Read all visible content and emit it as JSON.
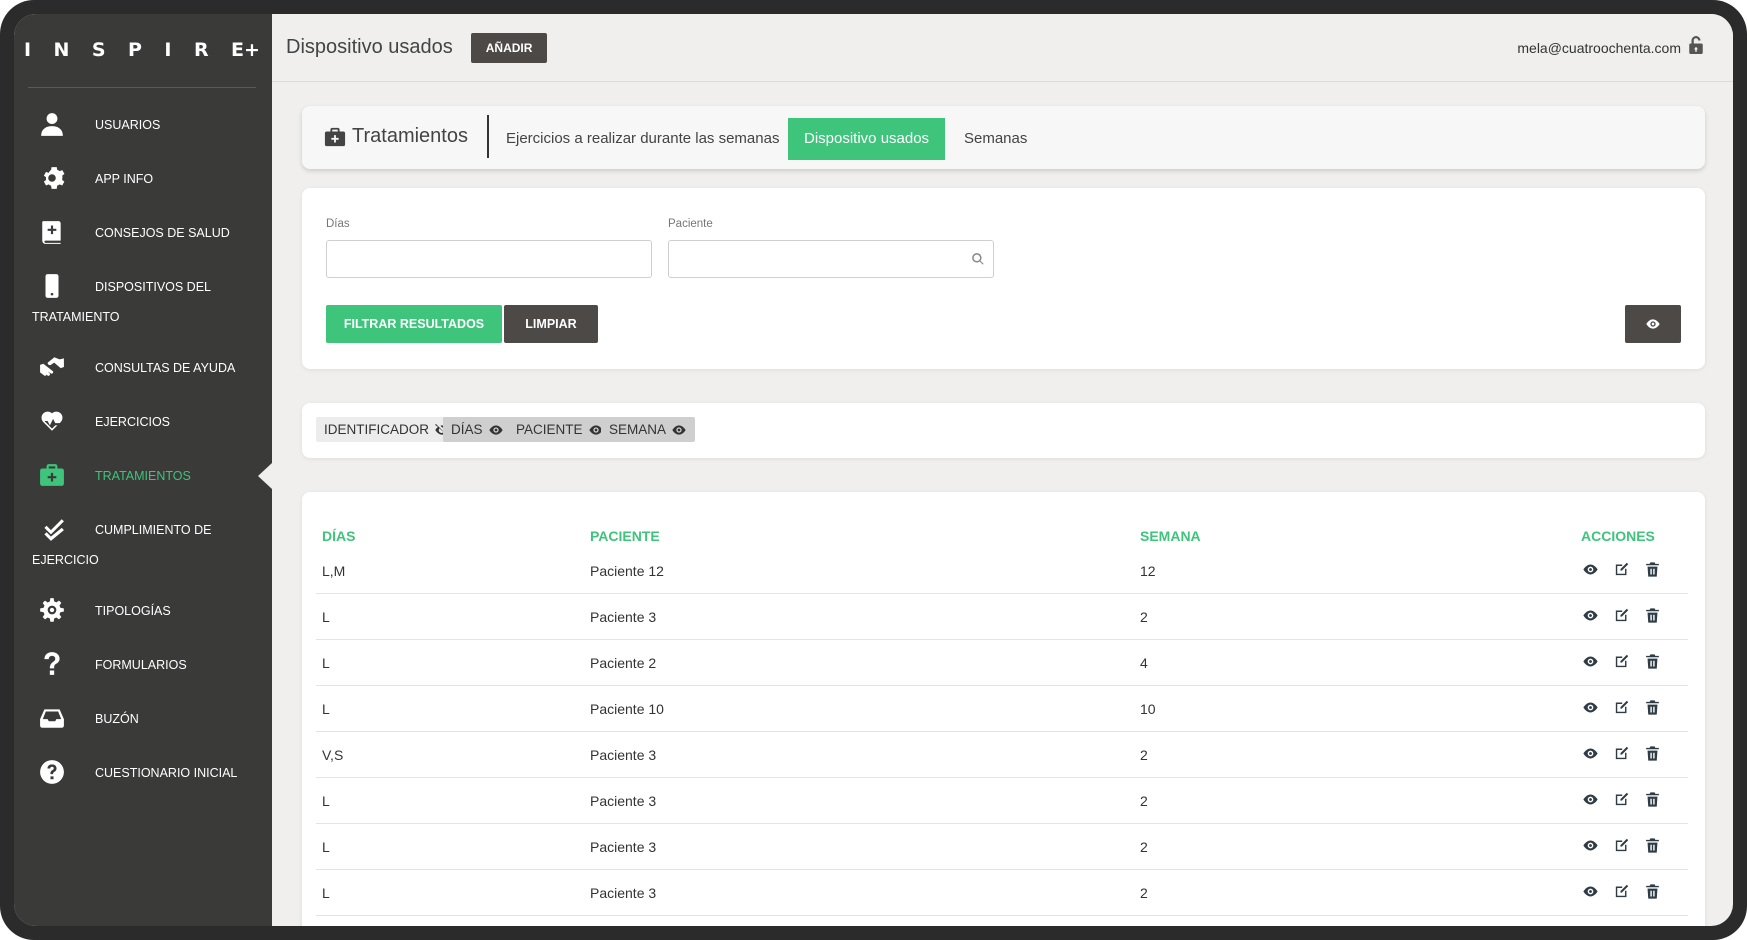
{
  "app": {
    "logo_letters": [
      "I",
      "N",
      "S",
      "P",
      "I",
      "R",
      "E+"
    ]
  },
  "sidebar": {
    "items": [
      {
        "label": "USUARIOS",
        "icon": "user-icon"
      },
      {
        "label": "APP INFO",
        "icon": "gear-icon"
      },
      {
        "label": "CONSEJOS DE SALUD",
        "icon": "medical-book-icon"
      },
      {
        "label": "DISPOSITIVOS DEL",
        "label2": "TRATAMIENTO",
        "icon": "mobile-icon"
      },
      {
        "label": "CONSULTAS DE AYUDA",
        "icon": "hands-helping-icon"
      },
      {
        "label": "EJERCICIOS",
        "icon": "heartbeat-icon"
      },
      {
        "label": "TRATAMIENTOS",
        "icon": "medkit-icon",
        "active": true
      },
      {
        "label": "CUMPLIMIENTO DE",
        "label2": "EJERCICIO",
        "icon": "double-check-icon"
      },
      {
        "label": "TIPOLOGÍAS",
        "icon": "cog-icon"
      },
      {
        "label": "FORMULARIOS",
        "icon": "question-icon"
      },
      {
        "label": "BUZÓN",
        "icon": "inbox-icon"
      },
      {
        "label": "CUESTIONARIO INICIAL",
        "icon": "question-circle-icon"
      }
    ]
  },
  "header": {
    "title": "Dispositivo usados",
    "add_label": "AÑADIR",
    "user_email": "mela@cuatroochenta.com"
  },
  "tabs": {
    "section_title": "Tratamientos",
    "items": [
      {
        "label": "Ejercicios a realizar durante las semanas",
        "active": false
      },
      {
        "label": "Dispositivo usados",
        "active": true
      },
      {
        "label": "Semanas",
        "active": false
      }
    ]
  },
  "filters": {
    "dias_label": "Días",
    "dias_value": "",
    "paciente_label": "Paciente",
    "paciente_value": "",
    "filter_button": "FILTRAR RESULTADOS",
    "clear_button": "LIMPIAR"
  },
  "columns_toggle": [
    {
      "label": "IDENTIFICADOR",
      "visible": false
    },
    {
      "label": "DÍAS",
      "visible": true
    },
    {
      "label": "PACIENTE",
      "visible": true
    },
    {
      "label": "SEMANA",
      "visible": true
    }
  ],
  "table": {
    "headers": [
      "DÍAS",
      "PACIENTE",
      "SEMANA",
      "ACCIONES"
    ],
    "rows": [
      {
        "dias": "L,M",
        "paciente": "Paciente 12",
        "semana": "12"
      },
      {
        "dias": "L",
        "paciente": "Paciente 3",
        "semana": "2"
      },
      {
        "dias": "L",
        "paciente": "Paciente 2",
        "semana": "4"
      },
      {
        "dias": "L",
        "paciente": "Paciente 10",
        "semana": "10"
      },
      {
        "dias": "V,S",
        "paciente": "Paciente 3",
        "semana": "2"
      },
      {
        "dias": "L",
        "paciente": "Paciente 3",
        "semana": "2"
      },
      {
        "dias": "L",
        "paciente": "Paciente 3",
        "semana": "2"
      },
      {
        "dias": "L",
        "paciente": "Paciente 3",
        "semana": "2"
      }
    ]
  },
  "colors": {
    "accent": "#3ec47b",
    "sidebar_bg": "#3a3a39",
    "dark_button": "#4d4947"
  }
}
